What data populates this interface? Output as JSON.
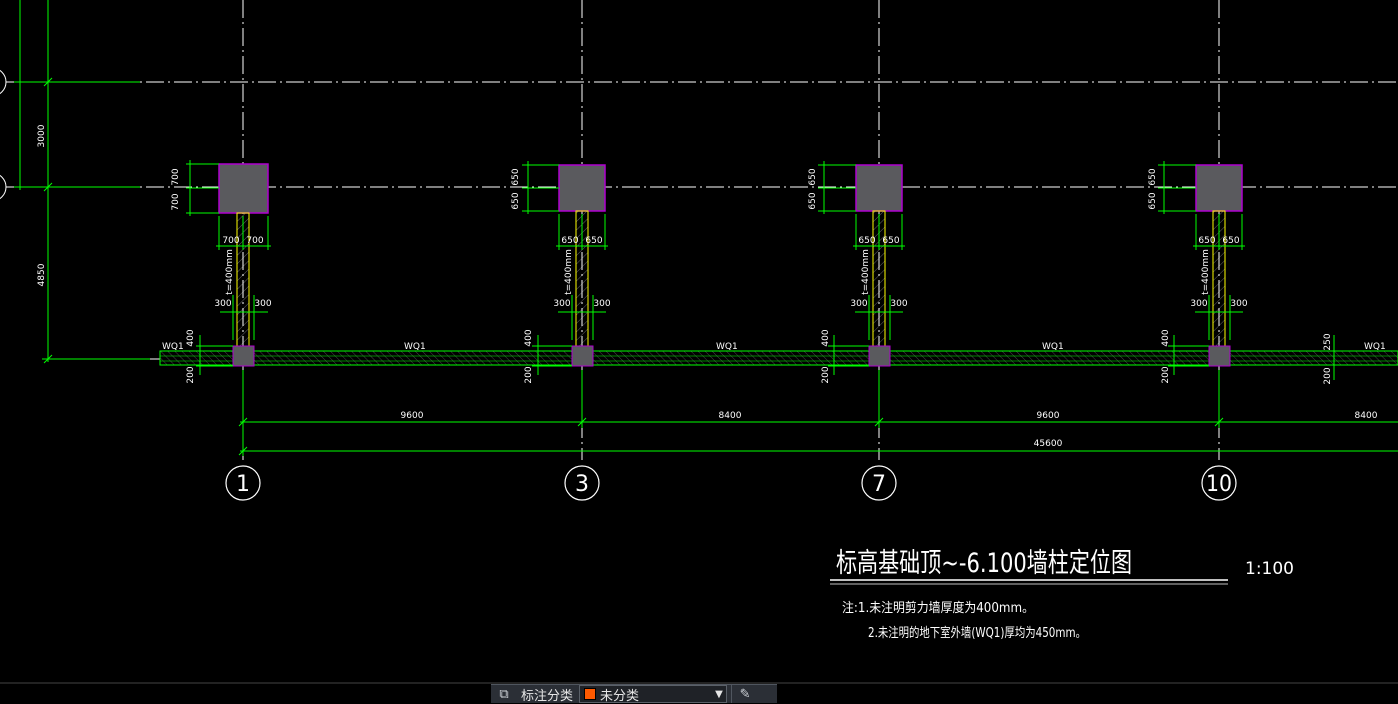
{
  "drawing": {
    "title": "标高基础顶~-6.100墙柱定位图",
    "scale": "1:100",
    "notes": [
      "注:1.未注明剪力墙厚度为400mm。",
      "2.未注明的地下室外墙(WQ1)厚均为450mm。"
    ],
    "axes": [
      "1",
      "3",
      "7",
      "10"
    ],
    "spans": [
      "9600",
      "8400",
      "9600",
      "8400"
    ],
    "total_span": "45600",
    "left_dims": [
      "3000",
      "4850"
    ],
    "wall_labels": [
      "WQ1",
      "WQ1",
      "WQ1",
      "WQ1",
      "WQ1"
    ],
    "wall_thickness_label": "t=400mm",
    "columns": [
      {
        "height_dims": [
          "700",
          "700"
        ],
        "width_dims": [
          "700",
          "700"
        ],
        "wall_dims": [
          "300",
          "300"
        ],
        "base_dims": [
          "400",
          "200"
        ]
      },
      {
        "height_dims": [
          "650",
          "650"
        ],
        "width_dims": [
          "650",
          "650"
        ],
        "wall_dims": [
          "300",
          "300"
        ],
        "base_dims": [
          "400",
          "200"
        ]
      },
      {
        "height_dims": [
          "650",
          "650"
        ],
        "width_dims": [
          "650",
          "650"
        ],
        "wall_dims": [
          "300",
          "300"
        ],
        "base_dims": [
          "400",
          "200"
        ]
      },
      {
        "height_dims": [
          "650",
          "650"
        ],
        "width_dims": [
          "650",
          "650"
        ],
        "wall_dims": [
          "300",
          "300"
        ],
        "base_dims": [
          "400",
          "200"
        ]
      }
    ],
    "right_base_dims": [
      "250",
      "200"
    ],
    "colors": {
      "background": "#000000",
      "dimension_green": "#00ff00",
      "axis_line": "#ffffff",
      "column_fill": "#5a5a5e",
      "column_border": "#b000d0",
      "wall_yellow": "#ffff00",
      "hatch": "#ffffff"
    }
  },
  "toolbar": {
    "left_icon": "annotation-icon",
    "label": "标注分类",
    "select_value": "未分类",
    "select_swatch": "#ff5a00",
    "edit_icon": "edit-icon"
  }
}
